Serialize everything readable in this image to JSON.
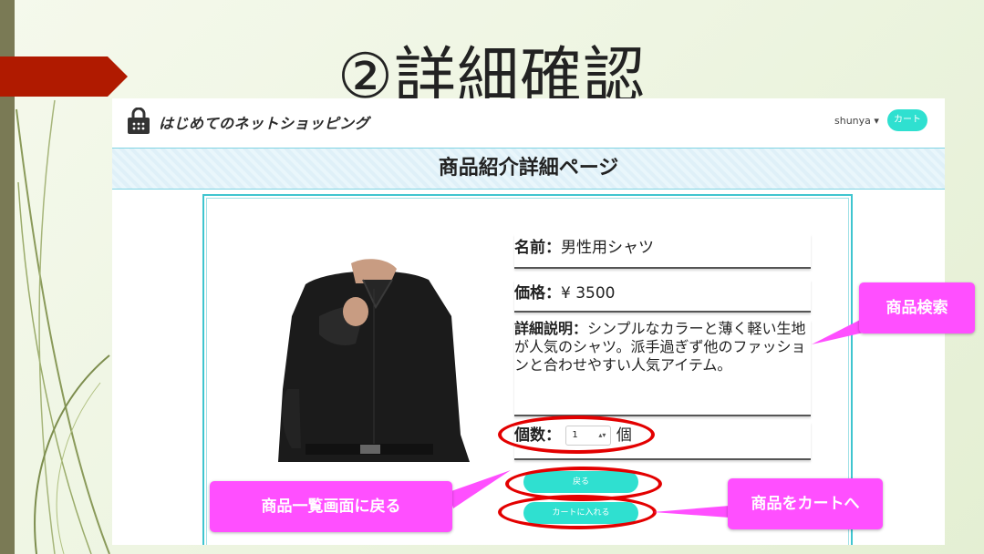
{
  "slide": {
    "title": "②詳細確認"
  },
  "app": {
    "brand": "はじめてのネットショッピング",
    "user": "shunya ▾",
    "cart_label": "カート",
    "page_heading": "商品紹介詳細ページ"
  },
  "product": {
    "name_label": "名前：",
    "name_value": "男性用シャツ",
    "price_label": "価格：",
    "price_value": "¥ 3500",
    "desc_label": "詳細説明：",
    "desc_value": "シンプルなカラーと薄く軽い生地が人気のシャツ。派手過ぎず他のファッションと合わせやすい人気アイテム。",
    "qty_label": "個数：",
    "qty_value": "1",
    "qty_unit": "個",
    "back_label": "戻る",
    "add_label": "カートに入れる"
  },
  "callouts": {
    "search": "商品検索",
    "back": "商品一覧画面に戻る",
    "add": "商品をカートへ"
  },
  "colors": {
    "accent": "#2fe0d0",
    "callout": "#ff4fff",
    "highlight": "#e30000",
    "banner": "#b01a00"
  }
}
